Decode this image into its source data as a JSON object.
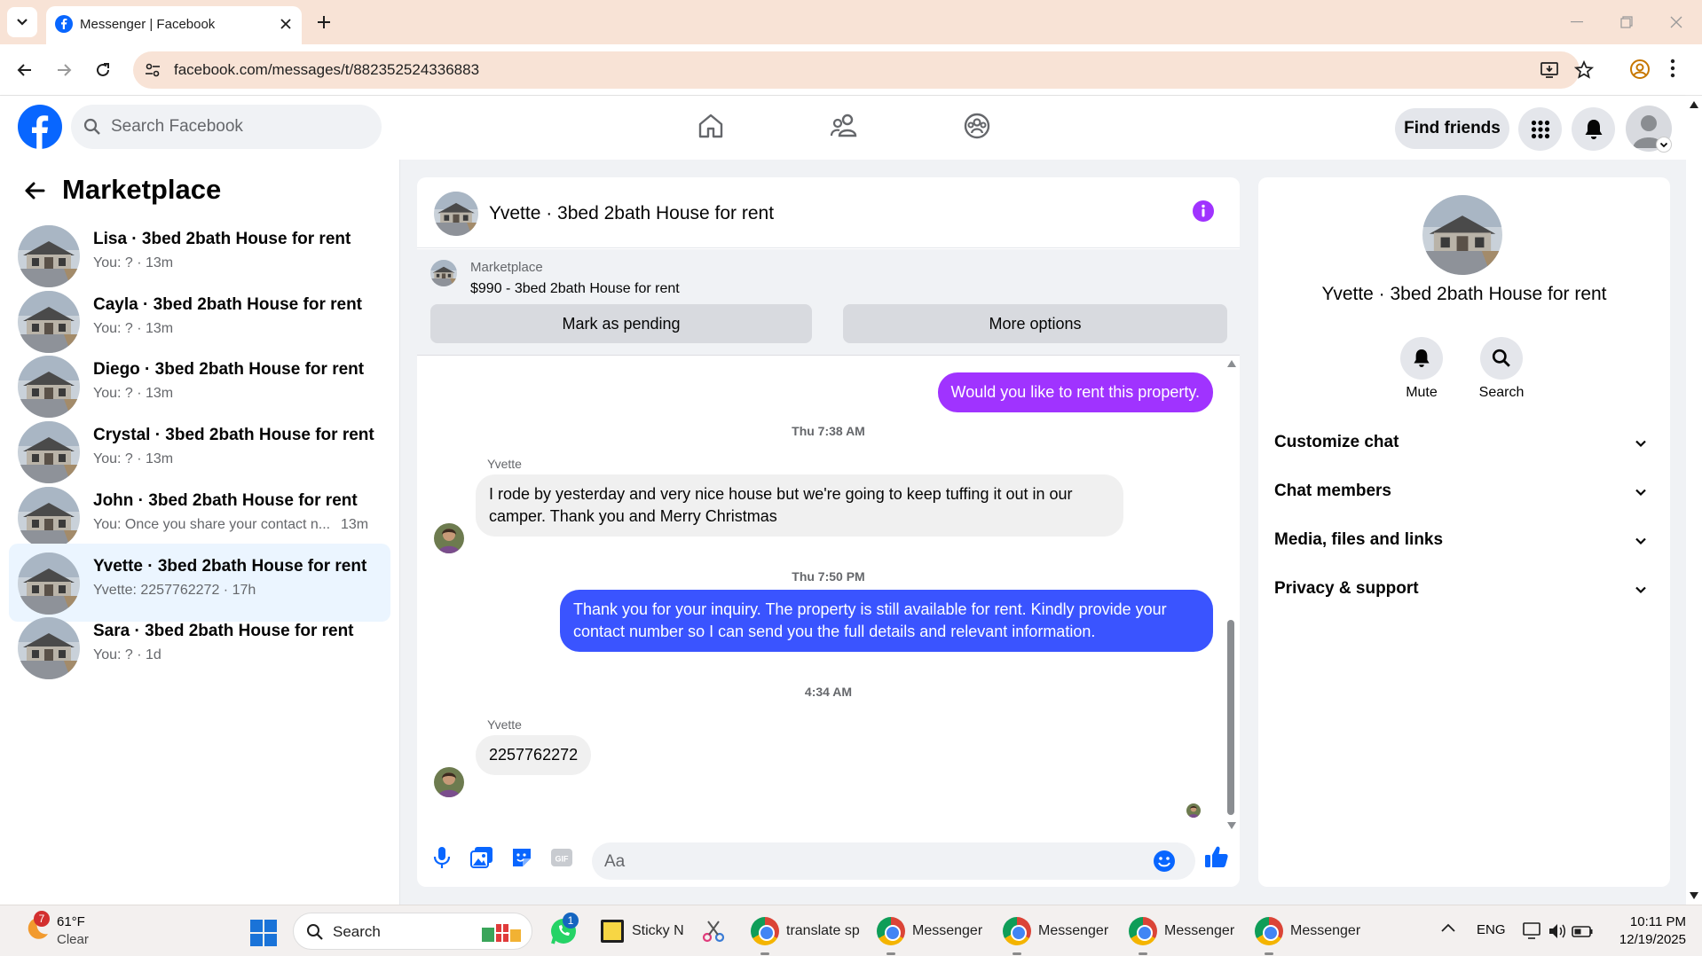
{
  "browser": {
    "tab_title": "Messenger | Facebook",
    "url": "facebook.com/messages/t/882352524336883"
  },
  "fb_header": {
    "search_placeholder": "Search Facebook",
    "find_friends_label": "Find friends"
  },
  "sidebar": {
    "title": "Marketplace",
    "conversations": [
      {
        "name": "Lisa · 3bed 2bath House for rent",
        "snippet": "You: ? · 13m",
        "selected": false
      },
      {
        "name": "Cayla · 3bed 2bath House for rent",
        "snippet": "You: ? · 13m",
        "selected": false
      },
      {
        "name": "Diego · 3bed 2bath House for rent",
        "snippet": "You: ? · 13m",
        "selected": false
      },
      {
        "name": "Crystal · 3bed 2bath House for rent",
        "snippet": "You: ? · 13m",
        "selected": false
      },
      {
        "name": "John · 3bed 2bath House for rent",
        "snippet": "You: Once you share your contact n...",
        "time": "13m",
        "selected": false
      },
      {
        "name": "Yvette · 3bed 2bath House for rent",
        "snippet": "Yvette: 2257762272 · 17h",
        "selected": true
      },
      {
        "name": "Sara · 3bed 2bath House for rent",
        "snippet": "You: ? · 1d",
        "selected": false
      }
    ]
  },
  "chat": {
    "title": "Yvette · 3bed 2bath House for rent",
    "marketplace_label": "Marketplace",
    "listing": "$990 - 3bed 2bath House for rent",
    "mark_pending_label": "Mark as pending",
    "more_options_label": "More options",
    "messages": {
      "m1": "Would you like to rent this property.",
      "ts1": "Thu 7:38 AM",
      "sender1": "Yvette",
      "m2": "I rode by yesterday and very nice house but we're going to keep tuffing it out in our camper.  Thank you and Merry Christmas",
      "ts2": "Thu 7:50 PM",
      "m3": "Thank you for your inquiry. The property is still available for rent. Kindly provide your contact number so I can send you the full details and relevant information.",
      "ts3": "4:34 AM",
      "sender2": "Yvette",
      "m4": "2257762272"
    },
    "input_placeholder": "Aa",
    "gif_label": "GIF"
  },
  "info_panel": {
    "name": "Yvette · 3bed 2bath House for rent",
    "mute_label": "Mute",
    "search_label": "Search",
    "sections": [
      "Customize chat",
      "Chat members",
      "Media, files and links",
      "Privacy & support"
    ]
  },
  "taskbar": {
    "weather_temp": "61°F",
    "weather_desc": "Clear",
    "weather_badge": "7",
    "search_label": "Search",
    "whatsapp_badge": "1",
    "apps": [
      "Sticky N",
      "translate sp",
      "Messenger",
      "Messenger",
      "Messenger",
      "Messenger"
    ],
    "lang": "ENG",
    "time": "10:11 PM",
    "date": "12/19/2025"
  },
  "colors": {
    "fb_blue": "#0866ff",
    "messenger_purple": "#a033ff",
    "messenger_blue": "#3a54ff",
    "selected_row": "#ebf5ff"
  }
}
